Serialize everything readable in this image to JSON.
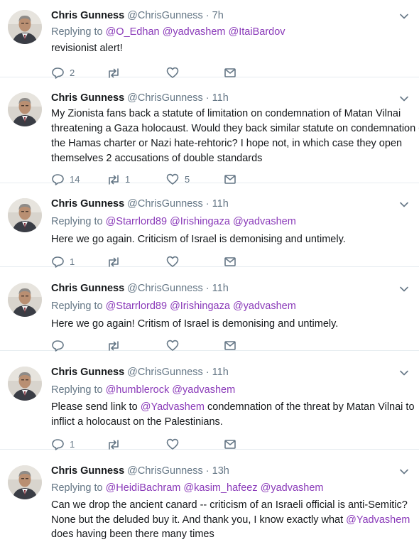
{
  "tweets": [
    {
      "name": "Chris Gunness",
      "handle": "@ChrisGunness",
      "sep": "·",
      "time": "7h",
      "reply_prefix": "Replying to",
      "mentions": [
        "@O_Edhan",
        "@yadvashem",
        "@ItaiBardov"
      ],
      "text": "revisionist alert!",
      "counts": {
        "reply": "2",
        "retweet": "",
        "like": ""
      }
    },
    {
      "name": "Chris Gunness",
      "handle": "@ChrisGunness",
      "sep": "·",
      "time": "11h",
      "text_lines": [
        "My Zionista fans back a statute of limitation on condemnation of Matan Vilnai",
        "threatening a Gaza holocaust. Would they back similar statute on condemnation of",
        "the Hamas charter or Nazi hate-rehtoric? I hope not, in which case they open",
        "themselves 2 accusations of double standards"
      ],
      "counts": {
        "reply": "14",
        "retweet": "1",
        "like": "5"
      }
    },
    {
      "name": "Chris Gunness",
      "handle": "@ChrisGunness",
      "sep": "·",
      "time": "11h",
      "reply_prefix": "Replying to",
      "mentions": [
        "@Starrlord89",
        "@Irishingaza",
        "@yadvashem"
      ],
      "text": "Here we go again. Criticism of Israel is demonising and untimely.",
      "counts": {
        "reply": "1",
        "retweet": "",
        "like": ""
      }
    },
    {
      "name": "Chris Gunness",
      "handle": "@ChrisGunness",
      "sep": "·",
      "time": "11h",
      "reply_prefix": "Replying to",
      "mentions": [
        "@Starrlord89",
        "@Irishingaza",
        "@yadvashem"
      ],
      "text": "Here we go again! Critism of Israel is demonising and untimely.",
      "counts": {
        "reply": "",
        "retweet": "",
        "like": ""
      }
    },
    {
      "name": "Chris Gunness",
      "handle": "@ChrisGunness",
      "sep": "·",
      "time": "11h",
      "reply_prefix": "Replying to",
      "mentions": [
        "@humblerock",
        "@yadvashem"
      ],
      "text_line1_before": "Please send link to",
      "text_line1_mention": "@Yadvashem",
      "text_line1_after": "condemnation of the threat by Matan Vilnai to",
      "text_line2": "inflict a holocaust on the Palestinians.",
      "counts": {
        "reply": "1",
        "retweet": "",
        "like": ""
      }
    },
    {
      "name": "Chris Gunness",
      "handle": "@ChrisGunness",
      "sep": "·",
      "time": "13h",
      "reply_prefix": "Replying to",
      "mentions": [
        "@HeidiBachram",
        "@kasim_hafeez",
        "@yadvashem"
      ],
      "text_line1": "Can we drop the ancient canard -- criticism of an Israeli official is anti-Semitic?",
      "text_line2_before": "None but the deluded buy it. And thank you, I know exactly what",
      "text_line2_mention": "@Yadvashem",
      "text_line3": "does having been there many times"
    }
  ],
  "icons": {
    "reply": "reply-icon",
    "retweet": "retweet-icon",
    "like": "like-icon",
    "dm": "message-icon",
    "caret": "chevron-down-icon"
  },
  "colors": {
    "text": "#14171a",
    "muted": "#657786",
    "link": "#8a3ab9",
    "divider": "#e6ecf0"
  }
}
